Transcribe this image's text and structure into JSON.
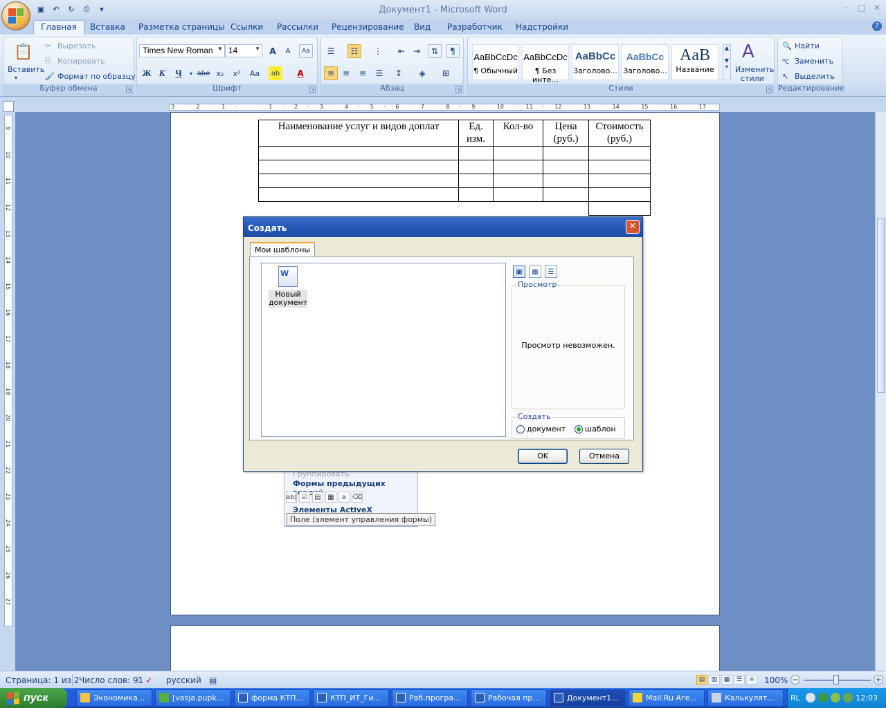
{
  "window": {
    "title": "Документ1 - Microsoft Word",
    "controls": [
      "–",
      "□",
      "✕"
    ]
  },
  "ribbon": {
    "tabs": [
      "Главная",
      "Вставка",
      "Разметка страницы",
      "Ссылки",
      "Рассылки",
      "Рецензирование",
      "Вид",
      "Разработчик",
      "Надстройки"
    ],
    "active_tab": "Главная",
    "clipboard": {
      "paste": "Вставить",
      "cut": "Вырезать",
      "copy": "Копировать",
      "format_painter": "Формат по образцу",
      "label": "Буфер обмена"
    },
    "font": {
      "name": "Times New Roman",
      "size": "14",
      "bold": "Ж",
      "italic": "К",
      "underline": "Ч",
      "strike": "abe",
      "sub": "x₂",
      "sup": "x²",
      "case": "Aa",
      "grow": "A",
      "shrink": "A",
      "clear": "Aa",
      "color": "A",
      "label": "Шрифт"
    },
    "paragraph": {
      "label": "Абзац",
      "pilcrow": "¶"
    },
    "styles": {
      "label": "Стили",
      "items": [
        {
          "sample": "AaBbCcDc",
          "name": "¶ Обычный"
        },
        {
          "sample": "AaBbCcDc",
          "name": "¶ Без инте..."
        },
        {
          "sample": "AaBbCc",
          "name": "Заголово..."
        },
        {
          "sample": "AaBbCc",
          "name": "Заголово..."
        },
        {
          "sample": "AaB",
          "name": "Название"
        }
      ],
      "change_styles": "Изменить",
      "change_styles_2": "стили"
    },
    "editing": {
      "label": "Редактирование",
      "find": "Найти",
      "replace": "Заменить",
      "select": "Выделить"
    }
  },
  "ruler": {
    "h_marks": [
      "3",
      "·",
      "2",
      "·",
      "1",
      "·",
      "",
      "·",
      "1",
      "·",
      "2",
      "·",
      "3",
      "·",
      "4",
      "·",
      "5",
      "·",
      "6",
      "·",
      "7",
      "·",
      "8",
      "·",
      "9",
      "·",
      "10",
      "·",
      "11",
      "·",
      "12",
      "·",
      "13",
      "·",
      "14",
      "·",
      "15",
      "·",
      "16",
      "·",
      "17",
      "·"
    ],
    "v_marks": [
      "9",
      "10",
      "11",
      "12",
      "13",
      "14",
      "15",
      "16",
      "17",
      "18",
      "19",
      "20",
      "21",
      "22",
      "23",
      "24",
      "25",
      "26",
      "27"
    ]
  },
  "document": {
    "table_headers": [
      "Наименование услуг и видов доплат",
      "Ед. изм.",
      "Кол-во",
      "Цена (руб.)",
      "Стоимость (руб.)"
    ]
  },
  "flyout": {
    "group_btn": "Группировать",
    "legacy_forms": "Формы предыдущих версий",
    "activex": "Элементы ActiveX",
    "tooltip": "Поле (элемент управления формы)"
  },
  "dialog": {
    "title": "Создать",
    "tab": "Мои шаблоны",
    "template": "Новый документ",
    "preview_legend": "Просмотр",
    "preview_msg": "Просмотр невозможен.",
    "create_legend": "Создать",
    "opt_document": "документ",
    "opt_template": "шаблон",
    "ok": "OK",
    "cancel": "Отмена"
  },
  "status": {
    "page": "Страница: 1 из 2",
    "words": "Число слов: 91",
    "lang": "русский",
    "zoom": "100%"
  },
  "taskbar": {
    "start": "пуск",
    "tasks": [
      "Экономика...",
      "[vasja.pupk...",
      "форма КТП...",
      "КТП_ИТ_Ги...",
      "Раб.програ...",
      "Рабочая пр...",
      "Документ1...",
      "Mail.Ru Аге...",
      "Калькулят..."
    ],
    "active_task": "Документ1...",
    "lang": "RL",
    "time": "12:03"
  },
  "colors": {
    "ribbon_text": "#15428b",
    "taskbar": "#245edb",
    "start": "#3a8e3a",
    "dialog_title": "#2458b8"
  }
}
